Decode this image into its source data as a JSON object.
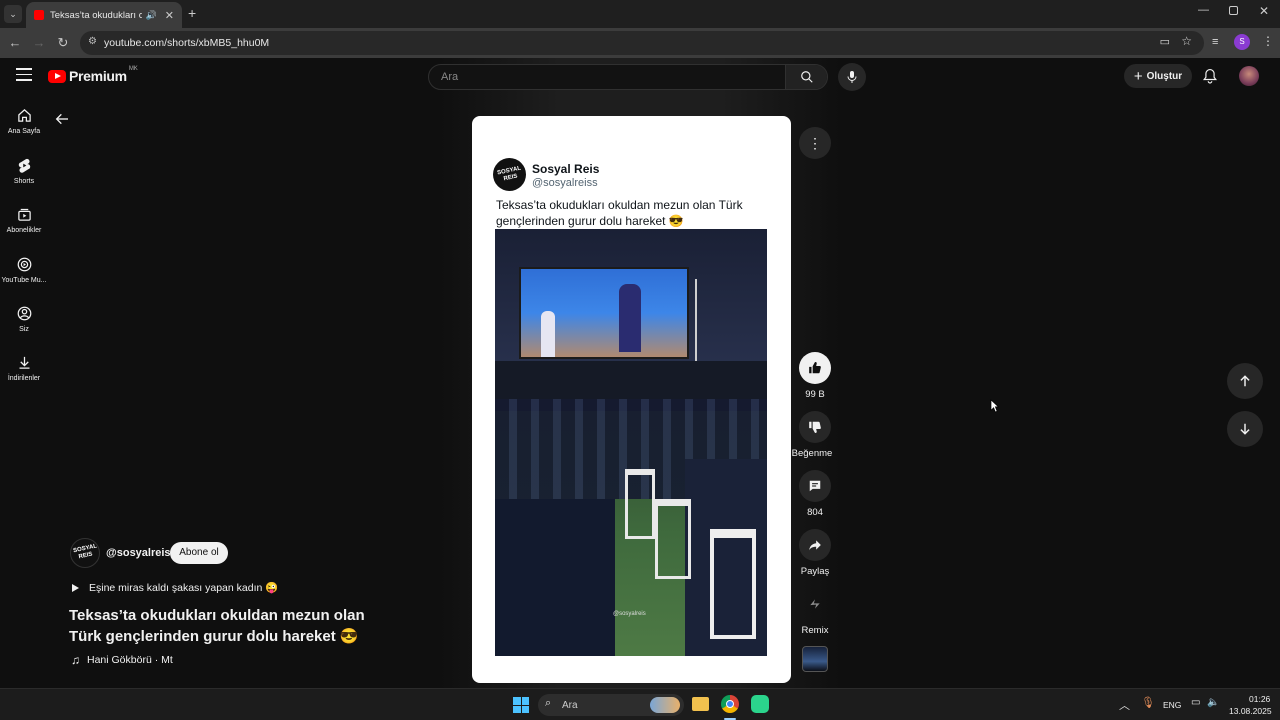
{
  "browser": {
    "tab_title": "Teksas’ta okudukları okuldan...",
    "url": "youtube.com/shorts/xbMB5_hhu0M"
  },
  "header": {
    "logo_text": "Premium",
    "logo_badge": "MK",
    "search_placeholder": "Ara",
    "create_label": "Oluştur"
  },
  "sidebar": {
    "items": [
      {
        "label": "Ana Sayfa",
        "icon": "home-icon"
      },
      {
        "label": "Shorts",
        "icon": "shorts-icon"
      },
      {
        "label": "Abonelikler",
        "icon": "subscriptions-icon"
      },
      {
        "label": "YouTube Mu...",
        "icon": "youtube-music-icon"
      },
      {
        "label": "Siz",
        "icon": "you-icon"
      },
      {
        "label": "İndirilenler",
        "icon": "downloads-icon"
      }
    ]
  },
  "card": {
    "author_name": "Sosyal Reis",
    "author_handle": "@sosyalreiss",
    "post_text": "Teksas’ta okudukları okuldan mezun olan Türk gençlerinden gurur dolu hareket 😎",
    "video_watermark": "@sosyalreis",
    "avatar_text": "SOSYAL REIS"
  },
  "actions": {
    "like_count": "99 B",
    "dislike_label": "Beğenme",
    "comment_count": "804",
    "share_label": "Paylaş",
    "remix_label": "Remix"
  },
  "channel": {
    "handle": "@sosyalreis",
    "subscribe_label": "Abone ol",
    "avatar_text": "SOSYAL REIS",
    "playlist_link": "Eşine miras kaldı şakası yapan kadın 😜",
    "title": "Teksas’ta okudukları okuldan mezun olan Türk gençlerinden gurur dolu hareket 😎",
    "music": "Hani Gökbörü · Mt"
  },
  "taskbar": {
    "search_label": "Ara",
    "lang": "ENG",
    "time": "01:26",
    "date": "13.08.2025"
  },
  "colors": {
    "accent_red": "#ff0000",
    "background": "#0f0f0f",
    "surface": "#272727"
  }
}
